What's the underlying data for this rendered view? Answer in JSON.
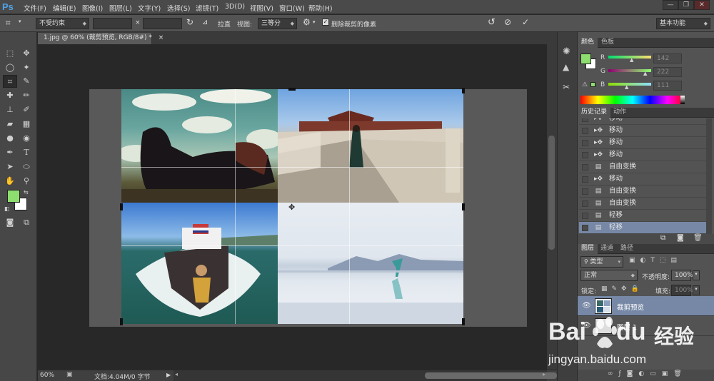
{
  "app": {
    "logo": "Ps"
  },
  "menu": [
    "文件(F)",
    "编辑(E)",
    "图像(I)",
    "图层(L)",
    "文字(Y)",
    "选择(S)",
    "滤镜(T)",
    "3D(D)",
    "视图(V)",
    "窗口(W)",
    "帮助(H)"
  ],
  "window_buttons": [
    "—",
    "❐",
    "✕"
  ],
  "options": {
    "ratio": "不受约束",
    "times": "×",
    "straighten": "拉直",
    "view_label": "视图:",
    "view_value": "三等分",
    "delete_cropped": "删除裁剪的像素",
    "workspace": "基本功能"
  },
  "document": {
    "tab": "1.jpg @ 60% (裁剪预览, RGB/8#) *",
    "tab_close": "×"
  },
  "status": {
    "zoom": "60%",
    "doc_info": "文档:4.04M/0 字节"
  },
  "color_panel": {
    "tabs": [
      "颜色",
      "色板"
    ],
    "channels": [
      {
        "label": "R",
        "value": "142"
      },
      {
        "label": "G",
        "value": "222"
      },
      {
        "label": "B",
        "value": "111"
      }
    ],
    "foreground": "#8ede6f",
    "background": "#ffffff"
  },
  "history_panel": {
    "tabs": [
      "历史记录",
      "动作"
    ],
    "items": [
      {
        "icon": "move-icon",
        "label": "移动"
      },
      {
        "icon": "move-icon",
        "label": "移动"
      },
      {
        "icon": "move-icon",
        "label": "移动"
      },
      {
        "icon": "move-icon",
        "label": "移动"
      },
      {
        "icon": "document-icon",
        "label": "自由变换"
      },
      {
        "icon": "move-icon",
        "label": "移动"
      },
      {
        "icon": "document-icon",
        "label": "自由变换"
      },
      {
        "icon": "document-icon",
        "label": "自由变换"
      },
      {
        "icon": "document-icon",
        "label": "轻移"
      },
      {
        "icon": "document-icon",
        "label": "轻移"
      }
    ]
  },
  "layers_panel": {
    "tabs": [
      "图层",
      "通道",
      "路径"
    ],
    "kind_filter": "类型",
    "blend_mode": "正常",
    "opacity_label": "不透明度:",
    "opacity_value": "100%",
    "lock_label": "锁定:",
    "fill_label": "填充:",
    "fill_value": "100%",
    "layers": [
      {
        "name": "裁剪预览",
        "selected": true
      },
      {
        "name": "图层 1",
        "selected": false
      }
    ]
  },
  "watermark": {
    "brand": "Bai",
    "brand2": "du",
    "cn": "经验",
    "url": "jingyan.baidu.com"
  }
}
